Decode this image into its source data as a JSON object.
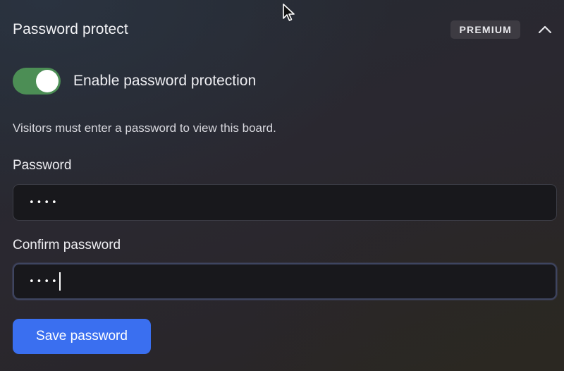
{
  "section": {
    "title": "Password protect",
    "badge": "PREMIUM",
    "collapse_icon": "chevron-up-icon"
  },
  "toggle": {
    "label": "Enable password protection",
    "enabled": true,
    "color": "#4c8e55"
  },
  "description": "Visitors must enter a password to view this board.",
  "password": {
    "label": "Password",
    "masked_value": "••••"
  },
  "confirm_password": {
    "label": "Confirm password",
    "masked_value": "••••"
  },
  "save_button": {
    "label": "Save password",
    "color": "#3a6ff0"
  }
}
